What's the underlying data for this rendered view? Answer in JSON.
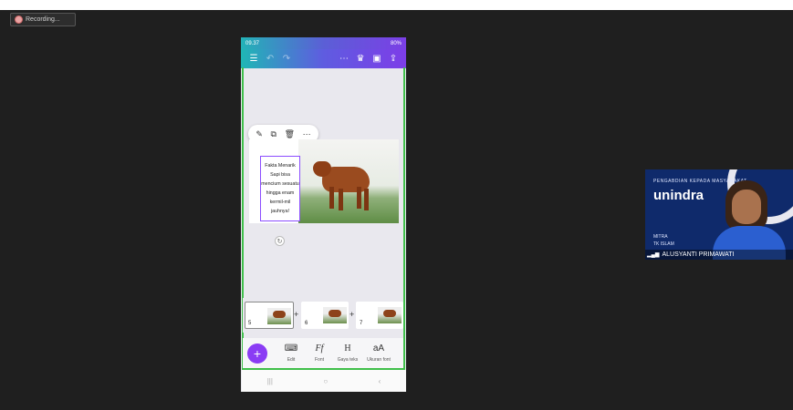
{
  "recording": {
    "label": "Recording..."
  },
  "status_bar": {
    "time": "09.37",
    "battery": "80%"
  },
  "toolbar": {
    "icons": [
      "menu-icon",
      "undo-icon",
      "redo-icon",
      "more-icon",
      "crown-icon",
      "present-icon",
      "share-icon"
    ]
  },
  "mini_toolbar": {
    "icons": [
      "magic-icon",
      "duplicate-icon",
      "trash-icon",
      "more-icon"
    ]
  },
  "slide": {
    "text": "Fakta Menarik\nSapi bisa\nmencium sesuatu\nhingga enam\nkermil-mil\njauhnya!"
  },
  "thumbnails": [
    {
      "number": "5"
    },
    {
      "number": "6"
    },
    {
      "number": "7"
    }
  ],
  "bottom_tools": [
    {
      "glyph": "⌨",
      "label": "Edit"
    },
    {
      "glyph": "Ff",
      "label": "Font"
    },
    {
      "glyph": "H",
      "label": "Gaya teks"
    },
    {
      "glyph": "aA",
      "label": "Ukuran font"
    }
  ],
  "video": {
    "org_line": "PENGABDIAN KEPADA MASYARAKAT",
    "brand": "unindra",
    "mitra_label": "MITRA",
    "mitra_name": "TK ISLAM",
    "participant": "ALUSYANTI PRIMAWATI"
  },
  "colors": {
    "accent": "#8a3cf4",
    "selection_border": "#3fbf4a",
    "toolbar_start": "#1fb7b5",
    "toolbar_end": "#7d3de8"
  }
}
